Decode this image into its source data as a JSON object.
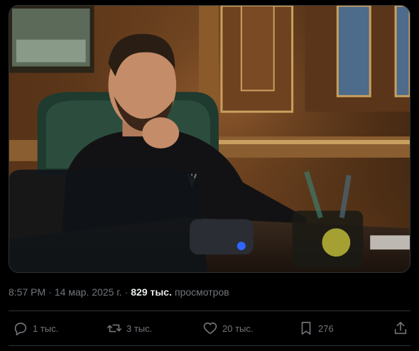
{
  "tweet": {
    "image": {
      "alt_icon": "photo-icon"
    },
    "meta": {
      "time": "8:57 PM",
      "separator": "·",
      "date": "14 мар. 2025 г.",
      "views_count": "829 тыс.",
      "views_label": "просмотров"
    },
    "actions": {
      "replies": "1 тыс.",
      "reposts": "3 тыс.",
      "likes": "20 тыс.",
      "bookmarks": "276"
    }
  },
  "colors": {
    "background": "#000000",
    "text_secondary": "#71767b",
    "text_primary": "#e7e9ea",
    "divider": "#2f3336"
  }
}
